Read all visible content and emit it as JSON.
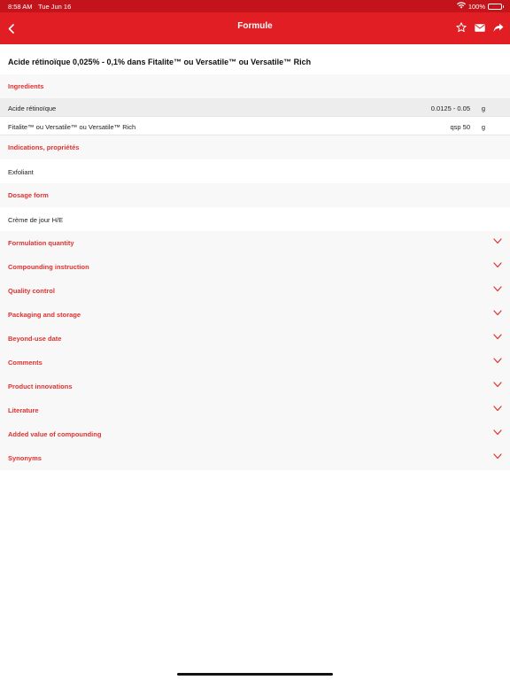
{
  "status_bar": {
    "time": "8:58 AM",
    "date": "Tue Jun 16",
    "battery": "100%"
  },
  "nav": {
    "title": "Formule"
  },
  "formula": {
    "title": "Acide rétinoïque 0,025% - 0,1% dans Fitalite™ ou Versatile™ ou Versatile™ Rich"
  },
  "ingredients": {
    "header": "Ingredients",
    "items": [
      {
        "name": "Acide rétinoïque",
        "qty": "0.0125 - 0.05",
        "unit": "g"
      },
      {
        "name": "Fitalite™ ou Versatile™ ou Versatile™ Rich",
        "qty": "qsp 50",
        "unit": "g"
      }
    ]
  },
  "indications": {
    "header": "Indications, propriétés",
    "value": "Exfoliant"
  },
  "dosage": {
    "header": "Dosage form",
    "value": "Crème de jour H/E"
  },
  "sections": [
    "Formulation quantity",
    "Compounding instruction",
    "Quality control",
    "Packaging and storage",
    "Beyond-use date",
    "Comments",
    "Product innovations",
    "Literature",
    "Added value of compounding",
    "Synonyms"
  ],
  "colors": {
    "status_bar": "#c3141c",
    "nav_bar": "#e01e24",
    "section_header_text": "#e0312f"
  }
}
